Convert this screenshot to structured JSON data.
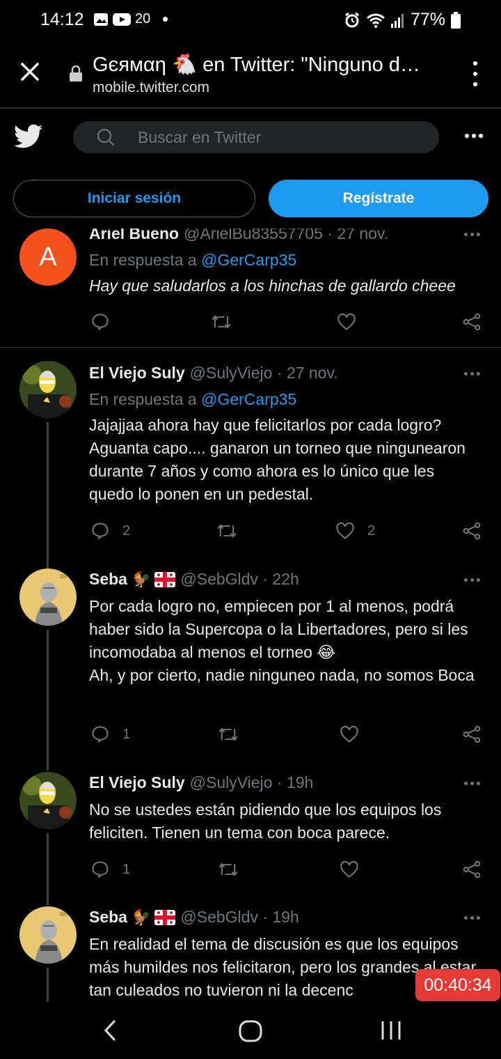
{
  "status_bar": {
    "time": "14:12",
    "temp": "20",
    "battery": "77%",
    "icons": [
      "gallery-icon",
      "youtube-icon",
      "weather-icon",
      "alarm-icon",
      "wifi-icon",
      "signal-icon",
      "battery-icon"
    ]
  },
  "browser": {
    "page_title": "Gєямαη 🐔 en Twitter: \"Ninguno d…",
    "url": "mobile.twitter.com"
  },
  "twitter": {
    "search_placeholder": "Buscar en Twitter",
    "login_label": "Iniciar sesión",
    "signup_label": "Regístrate"
  },
  "tweets": [
    {
      "name": "Ariel Bueno",
      "handle": "@ArielBu83557705 · 27 nov.",
      "avatar_letter": "A",
      "reply_prefix": "En respuesta a",
      "reply_mention": "@GerCarp35",
      "text": "Hay que saludarlos a los hinchas de gallardo cheee",
      "replies": "",
      "likes": ""
    },
    {
      "name": "El Viejo Suly",
      "handle": "@SulyViejo · 27 nov.",
      "reply_prefix": "En respuesta a",
      "reply_mention": "@GerCarp35",
      "text": "Jajajjaa ahora hay que felicitarlos por cada logro? Aguanta capo.... ganaron un torneo que ningunearon durante 7 años y como ahora es lo único que les quedo lo ponen en un pedestal.",
      "replies": "2",
      "likes": "2"
    },
    {
      "name": "Seba",
      "name_emoji": "🐓",
      "handle": "@SebGldv · 22h",
      "text_line1": "Por cada logro no, empiecen por 1 al menos, podrá haber sido la Supercopa o la Libertadores, pero si les incomodaba al menos el torneo 😂",
      "text_line2": "Ah, y por cierto, nadie ninguneo nada, no somos Boca",
      "replies": "1",
      "likes": ""
    },
    {
      "name": "El Viejo Suly",
      "handle": "@SulyViejo · 19h",
      "text": "No se ustedes están pidiendo que los equipos los feliciten. Tienen un tema con boca parece.",
      "replies": "1",
      "likes": ""
    },
    {
      "name": "Seba",
      "name_emoji": "🐓",
      "handle": "@SebGldv · 19h",
      "text": "En realidad el tema de discusión es que los equipos más humildes nos felicitaron, pero los grandes al estar tan culeados no tuvieron ni la decenc"
    }
  ],
  "overlay_timer": "00:40:34",
  "colors": {
    "accent": "#1d9bf0",
    "background": "#000000",
    "muted": "#71767b",
    "timer": "#e53935"
  }
}
